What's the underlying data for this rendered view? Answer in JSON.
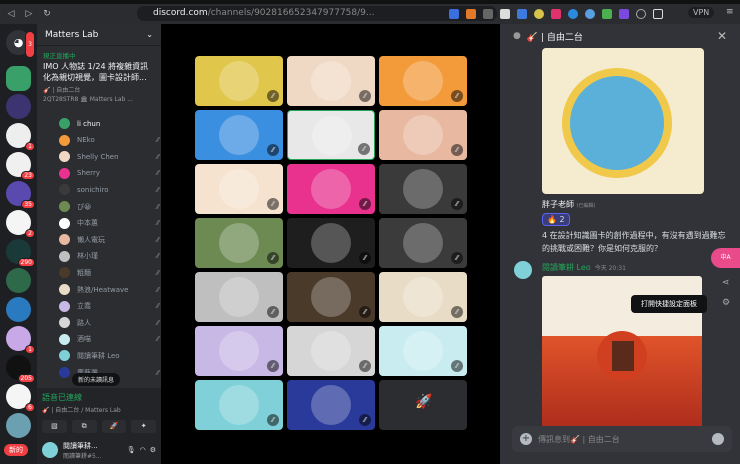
{
  "browser": {
    "url_host": "discord.com",
    "url_path": "/channels/902816652347977758/9...",
    "vpn": "VPN"
  },
  "server": {
    "name": "Matters Lab"
  },
  "live": {
    "label": "現正直播中",
    "title": "IMO 人物誌 1/24 將複雜資訊化為親切視覺，圖卡設計師...",
    "channel": "🎸 | 自由二台",
    "sub": "2QT28STR8 🏛 Matters Lab ..."
  },
  "rail_badges": [
    "3",
    "1",
    "23",
    "35",
    "2",
    "290",
    "1",
    "205",
    "6"
  ],
  "rail_new": "新的",
  "users": [
    "li chun",
    "NEko",
    "Shelly Chen",
    "Sherry",
    "sonichiro",
    "ぴ😀",
    "中本蕙",
    "懶人電玩",
    "林小瑾",
    "粗麵",
    "熱浪/Heatwave",
    "立喬",
    "路人",
    "酒喵",
    "閱讀筆耕 Leo",
    "廣藝署"
  ],
  "new_messages": "新的未讀訊息",
  "voice": {
    "status": "語音已連線",
    "channel": "🎸 | 自由二台 / Matters Lab"
  },
  "me": {
    "name": "閱讀筆耕...",
    "tag": "閱讀筆耕#5..."
  },
  "tile_colors": [
    "#e0c64a",
    "#f0d9c4",
    "#f39a3a",
    "#3b8fe0",
    "#e8e8e8",
    "#e8b8a0",
    "#f6e3cf",
    "#e9318e",
    "#3a3a3a",
    "#6d8a52",
    "#1e1e1e",
    "#3b3b3b",
    "#bfbfbf",
    "#4a3a2a",
    "#e8dcc6",
    "#c8b8e6",
    "#d6d6d6",
    "#c9ecf0",
    "#7fd0d8",
    "#2a3a9a",
    "#2b2d31"
  ],
  "chat": {
    "title": "🎸 | 自由二台",
    "msg1": {
      "author": "胖子老師",
      "edited": "(已編輯)",
      "reaction_emoji": "🔥",
      "reaction_count": "2",
      "text": "4 在設計知識圖卡的創作過程中，有沒有遇到過難忘的挑戰或困難？你是如何克服的？"
    },
    "msg2": {
      "author": "閱讀筆耕 Leo",
      "time": "今天 20:31"
    },
    "tooltip": "打開快捷設定面板",
    "translate": "中A",
    "placeholder": "傳訊息到🎸 | 自由二台"
  }
}
